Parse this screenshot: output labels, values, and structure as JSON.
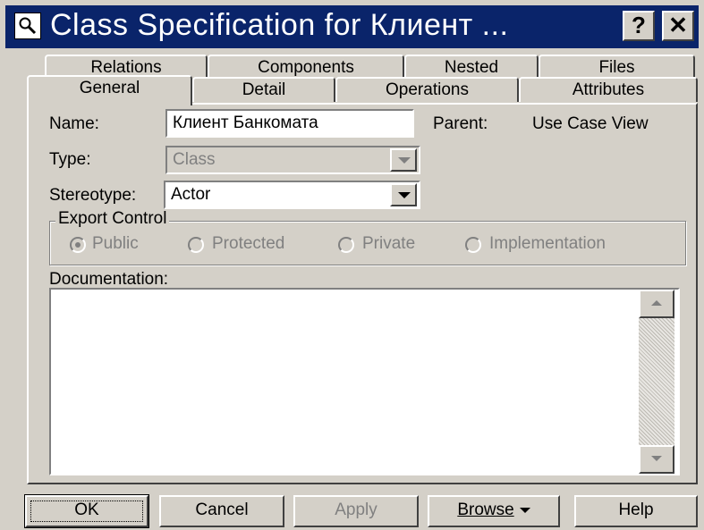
{
  "window": {
    "title": "Class Specification for Клиент ..."
  },
  "title_buttons": {
    "help": "?",
    "close": "✕"
  },
  "tabs": {
    "row1": [
      "Relations",
      "Components",
      "Nested",
      "Files"
    ],
    "row2": [
      "General",
      "Detail",
      "Operations",
      "Attributes"
    ],
    "active": "General"
  },
  "form": {
    "name_label": "Name:",
    "name_value": "Клиент Банкомата",
    "parent_label": "Parent:",
    "parent_value": "Use Case View",
    "type_label": "Type:",
    "type_value": "Class",
    "stereotype_label": "Stereotype:",
    "stereotype_value": "Actor",
    "export_control_label": "Export Control",
    "export_options": [
      "Public",
      "Protected",
      "Private",
      "Implementation"
    ],
    "export_selected": "Public",
    "documentation_label": "Documentation:",
    "documentation_value": ""
  },
  "buttons": {
    "ok": "OK",
    "cancel": "Cancel",
    "apply": "Apply",
    "browse": "Browse",
    "help": "Help"
  },
  "icons": {
    "title_icon": "magnifier-icon",
    "dropdown": "chevron-down-icon",
    "scroll_up": "scroll-up-arrow-icon",
    "scroll_down": "scroll-down-arrow-icon"
  },
  "colors": {
    "titlebar": "#0a246a",
    "face": "#d4d0c8",
    "disabled_text": "#808080"
  }
}
